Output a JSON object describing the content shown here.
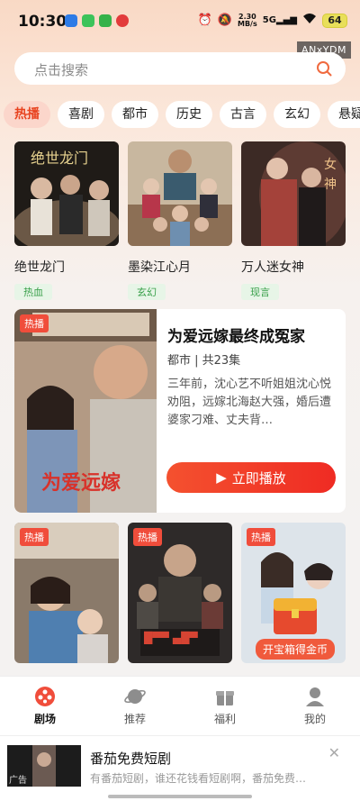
{
  "status_bar": {
    "time": "10:30",
    "speed_value": "2.30",
    "speed_unit": "MB/s",
    "network": "5G",
    "battery": "64"
  },
  "watermark": "ANxYDM",
  "search": {
    "placeholder": "点击搜索"
  },
  "tabs": [
    "热播",
    "喜剧",
    "都市",
    "历史",
    "古言",
    "玄幻",
    "悬疑"
  ],
  "top_cards": [
    {
      "title": "绝世龙门",
      "tag": "热血"
    },
    {
      "title": "墨染江心月",
      "tag": "玄幻"
    },
    {
      "title": "万人迷女神",
      "tag": "现言"
    }
  ],
  "featured": {
    "badge": "热播",
    "title": "为爱远嫁最终成冤家",
    "meta": "都市 | 共23集",
    "description": "三年前，沈心艺不听姐姐沈心悦劝阻，远嫁北海赵大强，婚后遭婆家刁难、丈夫背…",
    "play_label": "立即播放",
    "poster_text": "为爱远嫁"
  },
  "bottom_posters": [
    {
      "badge": "热播"
    },
    {
      "badge": "热播"
    },
    {
      "badge": "热播",
      "overlay": "开宝箱得金币"
    }
  ],
  "bottom_nav": [
    {
      "label": "剧场",
      "icon": "theater-icon",
      "active": true
    },
    {
      "label": "推荐",
      "icon": "planet-icon",
      "active": false
    },
    {
      "label": "福利",
      "icon": "gift-icon",
      "active": false
    },
    {
      "label": "我的",
      "icon": "profile-icon",
      "active": false
    }
  ],
  "ad": {
    "tag": "广告",
    "title": "番茄免费短剧",
    "subtitle": "有番茄短剧，谁还花钱看短剧啊，番茄免费…"
  },
  "colors": {
    "accent": "#f04d3b",
    "tag_green": "#39a04a",
    "active_tab_bg": "#fbd6cb"
  }
}
